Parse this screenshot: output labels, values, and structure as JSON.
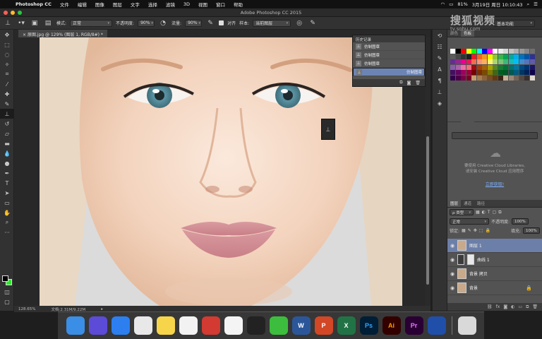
{
  "menubar": {
    "app": "Photoshop CC",
    "items": [
      "文件",
      "编辑",
      "图像",
      "图层",
      "文字",
      "选择",
      "滤镜",
      "3D",
      "视图",
      "窗口",
      "帮助"
    ],
    "battery": "81%",
    "datetime": "3月19日 周日 10:10:43"
  },
  "window": {
    "title": "Adobe Photoshop CC 2015"
  },
  "options": {
    "mode_label": "模式:",
    "mode_value": "正常",
    "opacity_label": "不透明度:",
    "opacity_value": "90%",
    "flow_label": "流量:",
    "flow_value": "90%",
    "align_label": "对齐",
    "sample_label": "样本:",
    "sample_value": "当前图层",
    "workspace": "基本功能"
  },
  "document": {
    "tab": "原图.jpg @ 129% (图层 1, RGB/8#) *",
    "zoom": "128.65%",
    "doc_info": "文档:2.31M/9.22M"
  },
  "history": {
    "title": "历史记录",
    "items": [
      {
        "label": "仿制图章"
      },
      {
        "label": "仿制图章"
      },
      {
        "label": "仿制图章"
      },
      {
        "label": "仿制图章"
      }
    ]
  },
  "swatches": {
    "tabs": [
      "颜色",
      "色板"
    ]
  },
  "libraries": {
    "tabs": [
      "调整",
      "样式"
    ],
    "message_line1": "要使用 Creative Cloud Libraries,",
    "message_line2": "请安装 Creative Cloud 应用程序",
    "link": "立即获取!"
  },
  "layers": {
    "tabs": [
      "图层",
      "通道",
      "路径"
    ],
    "filter_label": "ρ 类型",
    "blend": "正常",
    "opacity_label": "不透明度:",
    "opacity": "100%",
    "lock_label": "锁定:",
    "fill_label": "填充:",
    "fill": "100%",
    "items": [
      {
        "name": "图层 1",
        "active": true
      },
      {
        "name": "曲线 1",
        "active": false
      },
      {
        "name": "背景 拷贝",
        "active": false
      },
      {
        "name": "背景",
        "active": false
      }
    ]
  },
  "watermark": {
    "main": "搜狐视频",
    "sub": "tv.sohu.com"
  },
  "dock": {
    "apps": [
      {
        "name": "finder-app",
        "label": "",
        "color": "#3a8ee6"
      },
      {
        "name": "siri-app",
        "label": "",
        "color": "#5b4bd6"
      },
      {
        "name": "safari-app",
        "label": "",
        "color": "#2d7ff0"
      },
      {
        "name": "chrome-app",
        "label": "",
        "color": "#e8e8e8"
      },
      {
        "name": "notes-app",
        "label": "",
        "color": "#f7d54a"
      },
      {
        "name": "reminders-app",
        "label": "",
        "color": "#f2f2f2"
      },
      {
        "name": "netease-music-app",
        "label": "",
        "color": "#d33a31"
      },
      {
        "name": "baidu-netdisk-app",
        "label": "",
        "color": "#f4f4f4"
      },
      {
        "name": "qq-app",
        "label": "",
        "color": "#222222"
      },
      {
        "name": "wechat-app",
        "label": "",
        "color": "#3dbd3d"
      },
      {
        "name": "word-app",
        "label": "W",
        "color": "#2b579a"
      },
      {
        "name": "powerpoint-app",
        "label": "P",
        "color": "#d24726"
      },
      {
        "name": "excel-app",
        "label": "X",
        "color": "#217346"
      },
      {
        "name": "photoshop-app",
        "label": "Ps",
        "color": "#001e36"
      },
      {
        "name": "illustrator-app",
        "label": "Ai",
        "color": "#330000"
      },
      {
        "name": "premiere-app",
        "label": "Pr",
        "color": "#2a0034"
      },
      {
        "name": "app-unknown",
        "label": "",
        "color": "#1f4fa8"
      },
      {
        "name": "trash-app",
        "label": "",
        "color": "#d9d9d9"
      }
    ]
  }
}
